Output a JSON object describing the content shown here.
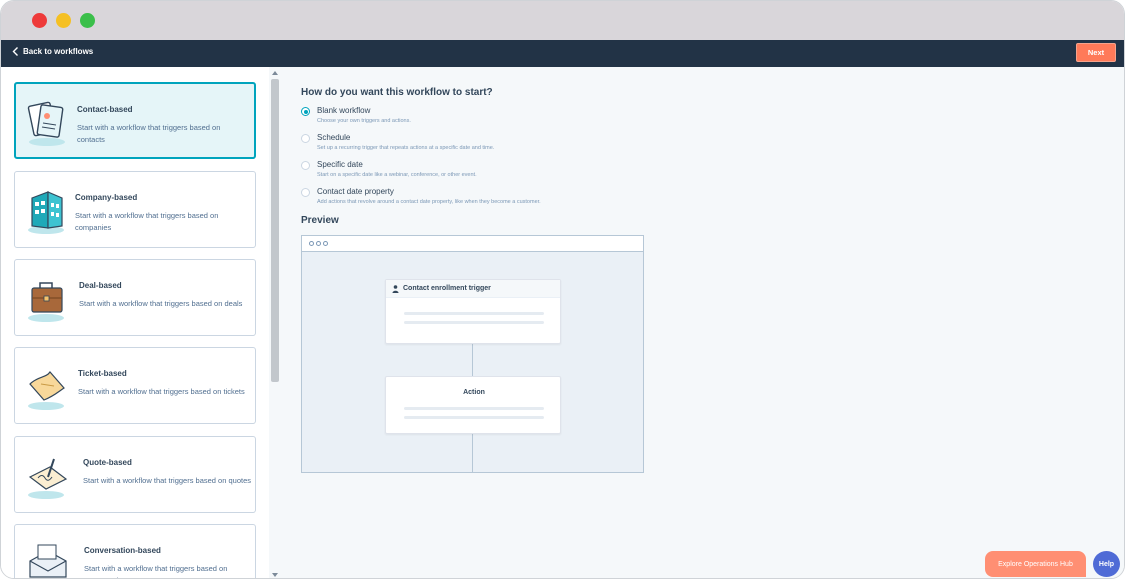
{
  "appbar": {
    "back_label": "Back to workflows",
    "next_label": "Next"
  },
  "cards": [
    {
      "title": "Contact-based",
      "desc": "Start with a workflow that triggers based on contacts",
      "icon": "contact-cards-icon"
    },
    {
      "title": "Company-based",
      "desc": "Start with a workflow that triggers based on companies",
      "icon": "building-icon"
    },
    {
      "title": "Deal-based",
      "desc": "Start with a workflow that triggers based on deals",
      "icon": "briefcase-icon"
    },
    {
      "title": "Ticket-based",
      "desc": "Start with a workflow that triggers based on tickets",
      "icon": "ticket-icon"
    },
    {
      "title": "Quote-based",
      "desc": "Start with a workflow that triggers based on quotes",
      "icon": "quote-signature-icon"
    },
    {
      "title": "Conversation-based",
      "desc": "Start with a workflow that triggers based on conversations",
      "icon": "envelope-icon"
    }
  ],
  "main": {
    "heading": "How do you want this workflow to start?",
    "options": [
      {
        "label": "Blank workflow",
        "desc": "Choose your own triggers and actions.",
        "checked": true
      },
      {
        "label": "Schedule",
        "desc": "Set up a recurring trigger that repeats actions at a specific date and time.",
        "checked": false
      },
      {
        "label": "Specific date",
        "desc": "Start on a specific date like a webinar, conference, or other event.",
        "checked": false
      },
      {
        "label": "Contact date property",
        "desc": "Add actions that revolve around a contact date property, like when they become a customer.",
        "checked": false
      }
    ],
    "preview_heading": "Preview",
    "preview": {
      "trigger_label": "Contact enrollment trigger",
      "action_label": "Action"
    }
  },
  "footer": {
    "explore_label": "Explore Operations Hub",
    "help_label": "Help"
  },
  "colors": {
    "accent": "#00a4bd",
    "primary_button": "#ff7a59",
    "nav": "#223346",
    "help": "#4f6bd6"
  }
}
